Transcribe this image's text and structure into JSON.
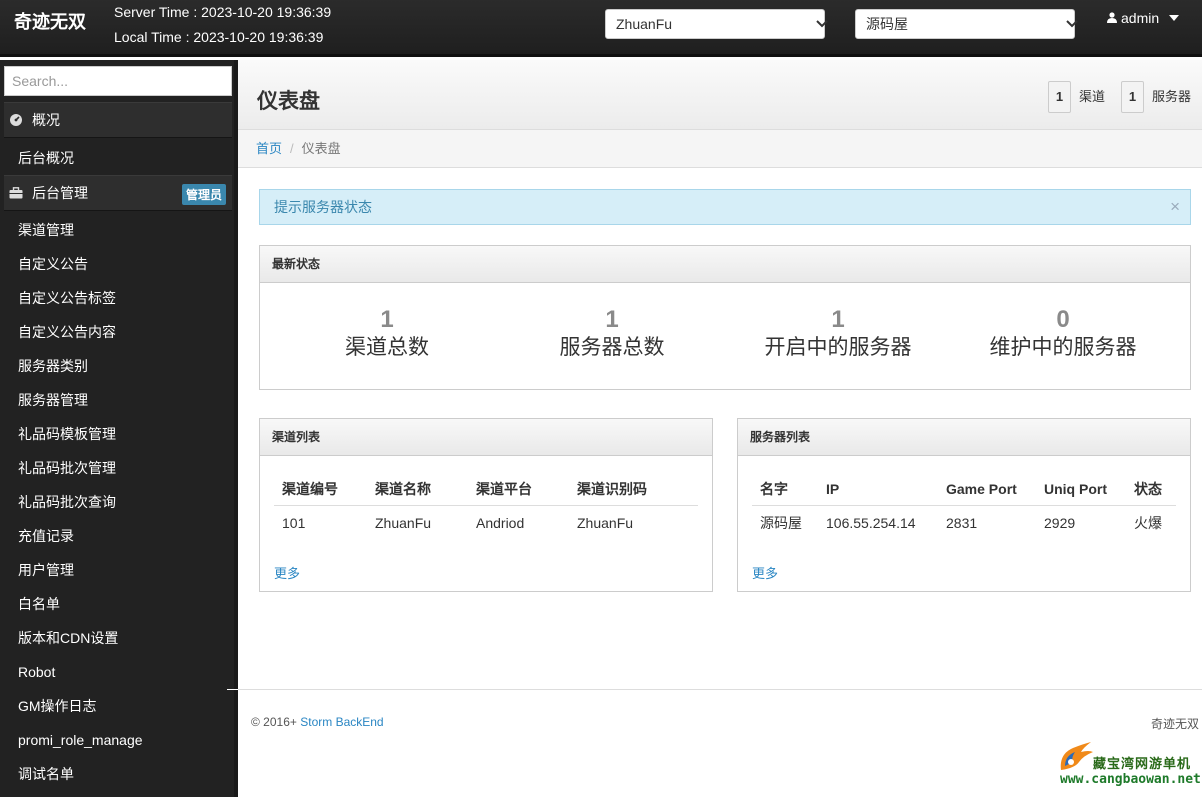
{
  "topbar": {
    "brand": "奇迹无双",
    "server_time": "Server Time : 2023-10-20 19:36:39",
    "local_time": "Local Time : 2023-10-20 19:36:39",
    "channel_select": "ZhuanFu",
    "server_select": "源码屋",
    "user": "admin"
  },
  "sidebar": {
    "search_placeholder": "Search...",
    "section_overview": "概况",
    "overview_item": "后台概况",
    "section_admin": "后台管理",
    "admin_badge": "管理员",
    "items": [
      "渠道管理",
      "自定义公告",
      "自定义公告标签",
      "自定义公告内容",
      "服务器类别",
      "服务器管理",
      "礼品码模板管理",
      "礼品码批次管理",
      "礼品码批次查询",
      "充值记录",
      "用户管理",
      "白名单",
      "版本和CDN设置",
      "Robot",
      "GM操作日志",
      "promi_role_manage",
      "调试名单"
    ]
  },
  "header": {
    "title": "仪表盘",
    "channel_count": "1",
    "channel_label": "渠道",
    "server_count": "1",
    "server_label": "服务器"
  },
  "breadcrumb": {
    "home": "首页",
    "current": "仪表盘"
  },
  "alert": {
    "text": "提示服务器状态",
    "close": "×"
  },
  "status_panel": {
    "title": "最新状态",
    "stats": [
      {
        "value": "1",
        "label": "渠道总数"
      },
      {
        "value": "1",
        "label": "服务器总数"
      },
      {
        "value": "1",
        "label": "开启中的服务器"
      },
      {
        "value": "0",
        "label": "维护中的服务器"
      }
    ]
  },
  "channel_panel": {
    "title": "渠道列表",
    "columns": [
      "渠道编号",
      "渠道名称",
      "渠道平台",
      "渠道识别码"
    ],
    "rows": [
      [
        "101",
        "ZhuanFu",
        "Andriod",
        "ZhuanFu"
      ]
    ],
    "more": "更多"
  },
  "server_panel": {
    "title": "服务器列表",
    "columns": [
      "名字",
      "IP",
      "Game Port",
      "Uniq Port",
      "状态"
    ],
    "rows": [
      [
        "源码屋",
        "106.55.254.14",
        "2831",
        "2929",
        "火爆"
      ]
    ],
    "more": "更多"
  },
  "footer": {
    "copyright": "© 2016+",
    "link": "Storm BackEnd",
    "right": "奇迹无双"
  },
  "watermark": {
    "text": "藏宝湾网游单机",
    "url": "www.cangbaowan.net"
  }
}
